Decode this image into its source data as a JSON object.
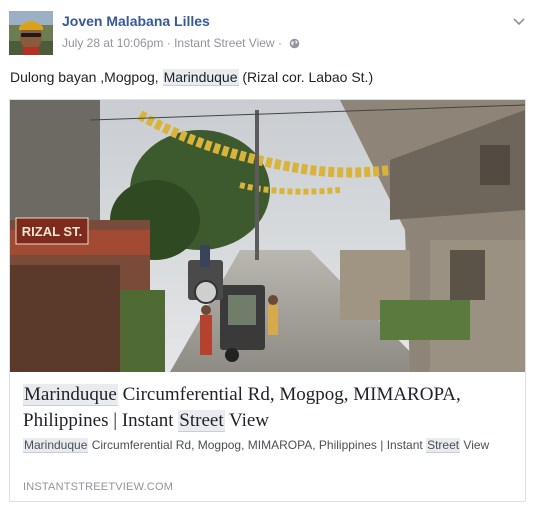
{
  "post": {
    "author": "Joven Malabana Lilles",
    "timestamp": "July 28 at 10:06pm",
    "separator": "·",
    "app": "Instant Street View",
    "privacy_icon": "globe-icon",
    "menu_icon": "chevron-down-icon",
    "text_before": "Dulong bayan ,Mogpog, ",
    "text_highlight": "Marinduque",
    "text_after": " (Rizal cor. Labao St.)"
  },
  "link_card": {
    "image_sign_text": "RIZAL ST.",
    "title_hl1": "Marinduque",
    "title_mid": " Circumferential Rd, Mogpog, MIMAROPA, Philippines | Instant ",
    "title_hl2": "Street",
    "title_end": " View",
    "desc_hl1": "Marinduque",
    "desc_mid": " Circumferential Rd, Mogpog, MIMAROPA, Philippines | Instant ",
    "desc_hl2": "Street",
    "desc_end": " View",
    "domain": "INSTANTSTREETVIEW.COM"
  },
  "colors": {
    "author_link": "#365899",
    "meta_gray": "#90949c",
    "highlight_bg": "#e9ebee",
    "card_border": "#dddfe2"
  }
}
